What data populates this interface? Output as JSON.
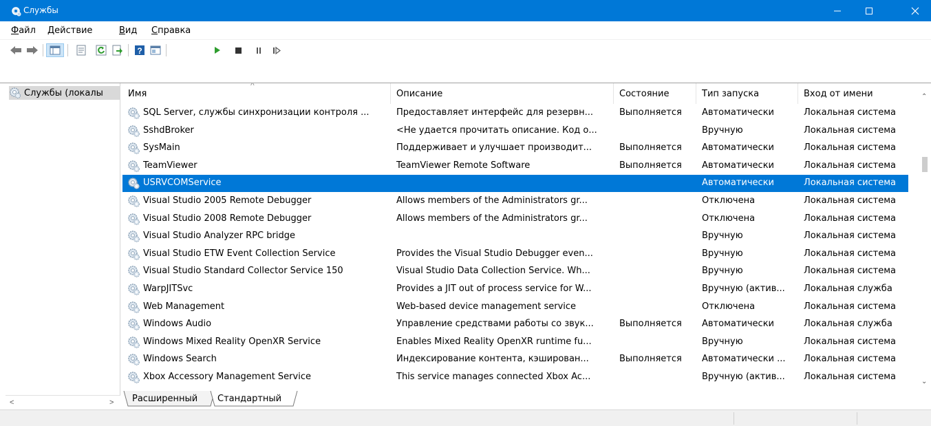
{
  "window": {
    "title": "Службы",
    "icon": "services-gear-icon"
  },
  "menu": {
    "items": [
      "Файл",
      "Действие",
      "Вид",
      "Справка"
    ]
  },
  "toolbar": {
    "icons": [
      "back-icon",
      "forward-icon",
      "console-tree-icon",
      "properties-icon",
      "refresh-icon",
      "export-icon",
      "help-icon",
      "view-icon",
      "start-service-icon",
      "stop-service-icon",
      "pause-service-icon",
      "resume-service-icon"
    ]
  },
  "tree": {
    "root_label": "Службы (локалы"
  },
  "table": {
    "columns": [
      "Имя",
      "Описание",
      "Состояние",
      "Тип запуска",
      "Вход от имени"
    ],
    "sort_indicator": "^",
    "rows": [
      {
        "name": "SQL Server, службы синхронизации контроля ...",
        "description": "Предоставляет интерфейс для резервн...",
        "status": "Выполняется",
        "startup": "Автоматически",
        "logon": "Локальная система"
      },
      {
        "name": "SshdBroker",
        "description": "<Не удается прочитать описание. Код о...",
        "status": "",
        "startup": "Вручную",
        "logon": "Локальная система"
      },
      {
        "name": "SysMain",
        "description": "Поддерживает и улучшает производит...",
        "status": "Выполняется",
        "startup": "Автоматически",
        "logon": "Локальная система"
      },
      {
        "name": "TeamViewer",
        "description": "TeamViewer Remote Software",
        "status": "Выполняется",
        "startup": "Автоматически",
        "logon": "Локальная система"
      },
      {
        "name": "USRVCOMService",
        "description": "",
        "status": "",
        "startup": "Автоматически",
        "logon": "Локальная система",
        "selected": true
      },
      {
        "name": "Visual Studio 2005 Remote Debugger",
        "description": "Allows members of the Administrators gr...",
        "status": "",
        "startup": "Отключена",
        "logon": "Локальная система"
      },
      {
        "name": "Visual Studio 2008 Remote Debugger",
        "description": "Allows members of the Administrators gr...",
        "status": "",
        "startup": "Отключена",
        "logon": "Локальная система"
      },
      {
        "name": "Visual Studio Analyzer RPC bridge",
        "description": "",
        "status": "",
        "startup": "Вручную",
        "logon": "Локальная система"
      },
      {
        "name": "Visual Studio ETW Event Collection Service",
        "description": "Provides the Visual Studio Debugger even...",
        "status": "",
        "startup": "Вручную",
        "logon": "Локальная система"
      },
      {
        "name": "Visual Studio Standard Collector Service 150",
        "description": "Visual Studio Data Collection Service. Wh...",
        "status": "",
        "startup": "Вручную",
        "logon": "Локальная система"
      },
      {
        "name": "WarpJITSvc",
        "description": "Provides a JIT out of process service for W...",
        "status": "",
        "startup": "Вручную (актив...",
        "logon": "Локальная служба"
      },
      {
        "name": "Web Management",
        "description": "Web-based device management service",
        "status": "",
        "startup": "Отключена",
        "logon": "Локальная система"
      },
      {
        "name": "Windows Audio",
        "description": "Управление средствами работы со звук...",
        "status": "Выполняется",
        "startup": "Автоматически",
        "logon": "Локальная служба"
      },
      {
        "name": "Windows Mixed Reality OpenXR Service",
        "description": "Enables Mixed Reality OpenXR runtime fu...",
        "status": "",
        "startup": "Вручную",
        "logon": "Локальная система"
      },
      {
        "name": "Windows Search",
        "description": "Индексирование контента, кэширован...",
        "status": "Выполняется",
        "startup": "Автоматически ...",
        "logon": "Локальная система"
      },
      {
        "name": "Xbox Accessory Management Service",
        "description": "This service manages connected Xbox Ac...",
        "status": "",
        "startup": "Вручную (актив...",
        "logon": "Локальная система"
      }
    ]
  },
  "tabs": {
    "extended": "Расширенный",
    "standard": "Стандартный",
    "active": "standard"
  },
  "colors": {
    "titlebar": "#0078d7",
    "selection": "#0078d7"
  }
}
